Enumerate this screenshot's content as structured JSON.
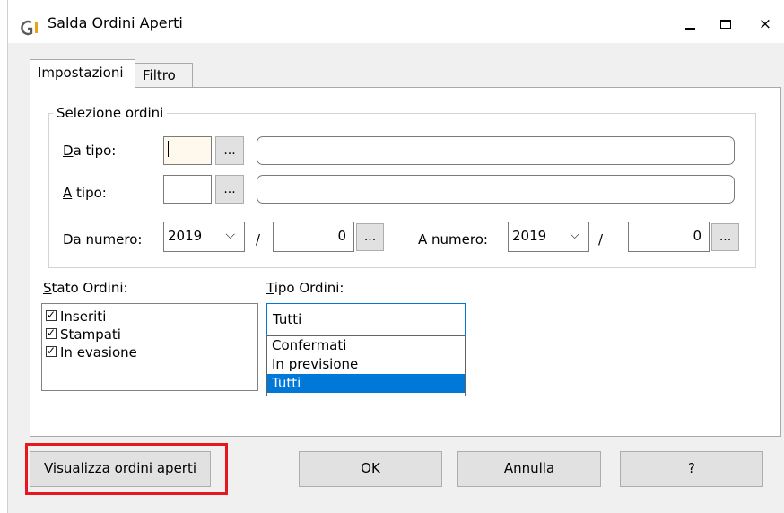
{
  "window": {
    "title": "Salda Ordini Aperti",
    "icon": "app-logo-icon",
    "close_glyph": "×"
  },
  "tabs": [
    {
      "label": "Impostazioni",
      "active": true
    },
    {
      "label": "Filtro",
      "active": false
    }
  ],
  "selection": {
    "group_label": "Selezione ordini",
    "da_tipo": {
      "accesskey": "D",
      "rest": "a tipo:",
      "value": "",
      "description": ""
    },
    "a_tipo": {
      "accesskey": "A",
      "rest": " tipo:",
      "value": "",
      "description": ""
    },
    "browse_label": "...",
    "da_numero": {
      "label": "Da numero:",
      "year": "2019",
      "number": "0"
    },
    "a_numero": {
      "label": "A numero:",
      "year": "2019",
      "number": "0"
    },
    "separator": "/",
    "combo_arrow": "⌵"
  },
  "stato": {
    "accesskey": "S",
    "rest": "tato Ordini:",
    "items": [
      {
        "label": "Inseriti",
        "checked": true
      },
      {
        "label": "Stampati",
        "checked": true
      },
      {
        "label": "In evasione",
        "checked": true
      }
    ],
    "check_glyph": "✓"
  },
  "tipo": {
    "accesskey": "T",
    "rest": "ipo Ordini:",
    "value": "Tutti",
    "options": [
      {
        "label": "Confermati",
        "selected": false
      },
      {
        "label": "In previsione",
        "selected": false
      },
      {
        "label": "Tutti",
        "selected": true
      }
    ]
  },
  "buttons": {
    "view": "Visualizza ordini aperti",
    "ok": "OK",
    "cancel": "Annulla",
    "help": "?"
  },
  "colors": {
    "highlight": "#e8171f",
    "selection": "#0078d7",
    "logo_accent": "#e8a317",
    "logo_gray": "#5a5a5a"
  }
}
